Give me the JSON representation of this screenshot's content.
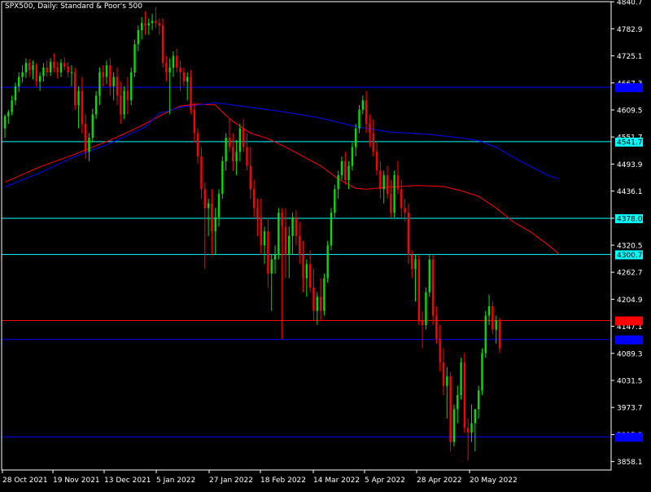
{
  "window": {
    "title": "SPX500, Daily:  Standard & Poor's 500"
  },
  "colors": {
    "background": "#000000",
    "bull": "#00e000",
    "bear": "#ff0000",
    "frame": "#ffffff",
    "ma_fast": "#ff0000",
    "ma_slow": "#0000ff",
    "level_blue": "#0000ff",
    "level_cyan": "#00ffff",
    "level_red": "#ff0000"
  },
  "chart_data": {
    "type": "candlestick",
    "symbol": "SPX500",
    "timeframe": "Daily",
    "title": "SPX500, Daily:  Standard & Poor's 500",
    "y_axis": {
      "ticks": [
        3858.1,
        3915.9,
        3973.7,
        4031.5,
        4089.3,
        4147.1,
        4204.9,
        4262.7,
        4320.5,
        4378.0,
        4436.1,
        4493.9,
        4551.7,
        4609.5,
        4667.3,
        4725.1,
        4782.9,
        4840.7
      ],
      "tick_labels": [
        "3858.1",
        "3915.9",
        "3973.7",
        "4031.5",
        "4089.3",
        "4147.1",
        "4204.9",
        "4262.7",
        "4320.5",
        "4378.0",
        "4436.1",
        "4493.9",
        "4551.7",
        "4609.5",
        "4667.3",
        "4725.1",
        "4782.9",
        "4840.7"
      ],
      "range": [
        3840,
        4841
      ]
    },
    "x_axis": {
      "labels": [
        "28 Oct 2021",
        "19 Nov 2021",
        "13 Dec 2021",
        "5 Jan 2022",
        "27 Jan 2022",
        "18 Feb 2022",
        "14 Mar 2022",
        "5 Apr 2022",
        "28 Apr 2022",
        "20 May 2022"
      ]
    },
    "horizontal_levels": [
      {
        "value": 4658.0,
        "label": "4658.0",
        "color": "#0000ff",
        "label_bg": "#0000ff",
        "label_color": "#0000ff"
      },
      {
        "value": 4541.7,
        "label": "4541.7",
        "color": "#00ffff",
        "label_bg": "#00ffff",
        "label_color": "#000000"
      },
      {
        "value": 4378.0,
        "label": "4378.0",
        "color": "#00ffff",
        "label_bg": "#00ffff",
        "label_color": "#000000"
      },
      {
        "value": 4300.7,
        "label": "4300.7",
        "color": "#00ffff",
        "label_bg": "#00ffff",
        "label_color": "#000000"
      },
      {
        "value": 4159.5,
        "label": "4159.5",
        "color": "#ff0000",
        "label_bg": "#ff0000",
        "label_color": "#ff0000"
      },
      {
        "value": 4119.0,
        "label": "4119.0",
        "color": "#0000ff",
        "label_bg": "#0000ff",
        "label_color": "#0000ff"
      },
      {
        "value": 3911.0,
        "label": "3911.0",
        "color": "#0000ff",
        "label_bg": "#0000ff",
        "label_color": "#0000ff"
      }
    ],
    "moving_averages": [
      {
        "color": "#ff0000",
        "points": [
          [
            0,
            4455
          ],
          [
            10,
            4488
          ],
          [
            20,
            4515
          ],
          [
            30,
            4545
          ],
          [
            35,
            4562
          ],
          [
            40,
            4580
          ],
          [
            45,
            4600
          ],
          [
            50,
            4618
          ],
          [
            55,
            4622
          ],
          [
            60,
            4620
          ],
          [
            62,
            4605
          ],
          [
            65,
            4585
          ],
          [
            68,
            4570
          ],
          [
            70,
            4560
          ],
          [
            75,
            4548
          ],
          [
            80,
            4530
          ],
          [
            85,
            4510
          ],
          [
            90,
            4490
          ],
          [
            95,
            4462
          ],
          [
            100,
            4442
          ],
          [
            103,
            4440
          ],
          [
            110,
            4445
          ],
          [
            118,
            4448
          ],
          [
            125,
            4446
          ],
          [
            130,
            4437
          ],
          [
            135,
            4425
          ],
          [
            140,
            4400
          ],
          [
            145,
            4370
          ],
          [
            150,
            4348
          ],
          [
            155,
            4320
          ],
          [
            158,
            4301
          ]
        ]
      },
      {
        "color": "#0000ff",
        "points": [
          [
            0,
            4445
          ],
          [
            10,
            4475
          ],
          [
            20,
            4510
          ],
          [
            30,
            4538
          ],
          [
            40,
            4573
          ],
          [
            44,
            4602
          ],
          [
            50,
            4615
          ],
          [
            60,
            4625
          ],
          [
            70,
            4615
          ],
          [
            80,
            4605
          ],
          [
            90,
            4592
          ],
          [
            100,
            4574
          ],
          [
            110,
            4562
          ],
          [
            120,
            4558
          ],
          [
            130,
            4550
          ],
          [
            135,
            4544
          ],
          [
            140,
            4530
          ],
          [
            145,
            4508
          ],
          [
            150,
            4488
          ],
          [
            155,
            4469
          ],
          [
            158,
            4462
          ]
        ]
      }
    ],
    "candles": [
      [
        4570,
        4600,
        4550,
        4596
      ],
      [
        4596,
        4610,
        4580,
        4605
      ],
      [
        4605,
        4640,
        4598,
        4630
      ],
      [
        4630,
        4668,
        4620,
        4660
      ],
      [
        4660,
        4690,
        4648,
        4680
      ],
      [
        4680,
        4705,
        4668,
        4690
      ],
      [
        4690,
        4720,
        4678,
        4710
      ],
      [
        4710,
        4718,
        4680,
        4695
      ],
      [
        4695,
        4715,
        4675,
        4705
      ],
      [
        4705,
        4710,
        4660,
        4670
      ],
      [
        4670,
        4690,
        4650,
        4682
      ],
      [
        4682,
        4710,
        4670,
        4700
      ],
      [
        4700,
        4715,
        4680,
        4690
      ],
      [
        4690,
        4720,
        4682,
        4712
      ],
      [
        4712,
        4730,
        4690,
        4700
      ],
      [
        4700,
        4712,
        4676,
        4690
      ],
      [
        4690,
        4718,
        4680,
        4710
      ],
      [
        4710,
        4722,
        4695,
        4702
      ],
      [
        4702,
        4712,
        4680,
        4690
      ],
      [
        4690,
        4705,
        4660,
        4690
      ],
      [
        4690,
        4700,
        4610,
        4620
      ],
      [
        4620,
        4660,
        4570,
        4650
      ],
      [
        4650,
        4680,
        4560,
        4580
      ],
      [
        4580,
        4600,
        4505,
        4520
      ],
      [
        4520,
        4560,
        4500,
        4550
      ],
      [
        4550,
        4612,
        4540,
        4600
      ],
      [
        4600,
        4650,
        4590,
        4640
      ],
      [
        4640,
        4700,
        4620,
        4690
      ],
      [
        4690,
        4705,
        4660,
        4680
      ],
      [
        4680,
        4715,
        4665,
        4705
      ],
      [
        4705,
        4720,
        4640,
        4660
      ],
      [
        4660,
        4690,
        4630,
        4680
      ],
      [
        4680,
        4700,
        4620,
        4640
      ],
      [
        4640,
        4670,
        4580,
        4600
      ],
      [
        4600,
        4660,
        4590,
        4650
      ],
      [
        4650,
        4680,
        4600,
        4630
      ],
      [
        4630,
        4700,
        4620,
        4690
      ],
      [
        4690,
        4760,
        4680,
        4750
      ],
      [
        4750,
        4790,
        4735,
        4780
      ],
      [
        4780,
        4808,
        4760,
        4795
      ],
      [
        4795,
        4820,
        4770,
        4790
      ],
      [
        4790,
        4805,
        4770,
        4795
      ],
      [
        4795,
        4815,
        4780,
        4800
      ],
      [
        4800,
        4830,
        4785,
        4795
      ],
      [
        4795,
        4805,
        4770,
        4790
      ],
      [
        4790,
        4805,
        4700,
        4710
      ],
      [
        4710,
        4725,
        4670,
        4690
      ],
      [
        4690,
        4720,
        4600,
        4700
      ],
      [
        4700,
        4735,
        4680,
        4725
      ],
      [
        4725,
        4740,
        4690,
        4700
      ],
      [
        4700,
        4715,
        4650,
        4690
      ],
      [
        4690,
        4700,
        4660,
        4670
      ],
      [
        4670,
        4690,
        4630,
        4680
      ],
      [
        4680,
        4695,
        4600,
        4610
      ],
      [
        4610,
        4625,
        4540,
        4560
      ],
      [
        4560,
        4570,
        4495,
        4510
      ],
      [
        4510,
        4530,
        4420,
        4440
      ],
      [
        4440,
        4455,
        4270,
        4400
      ],
      [
        4400,
        4420,
        4340,
        4410
      ],
      [
        4410,
        4440,
        4300,
        4350
      ],
      [
        4350,
        4400,
        4300,
        4380
      ],
      [
        4380,
        4440,
        4360,
        4430
      ],
      [
        4430,
        4510,
        4420,
        4500
      ],
      [
        4500,
        4560,
        4480,
        4550
      ],
      [
        4550,
        4590,
        4520,
        4530
      ],
      [
        4530,
        4560,
        4480,
        4500
      ],
      [
        4500,
        4545,
        4470,
        4520
      ],
      [
        4520,
        4580,
        4500,
        4570
      ],
      [
        4570,
        4590,
        4520,
        4530
      ],
      [
        4530,
        4560,
        4480,
        4490
      ],
      [
        4490,
        4530,
        4420,
        4440
      ],
      [
        4440,
        4460,
        4380,
        4400
      ],
      [
        4400,
        4420,
        4340,
        4380
      ],
      [
        4380,
        4420,
        4300,
        4320
      ],
      [
        4320,
        4360,
        4280,
        4350
      ],
      [
        4350,
        4380,
        4230,
        4260
      ],
      [
        4260,
        4300,
        4180,
        4290
      ],
      [
        4290,
        4320,
        4260,
        4300
      ],
      [
        4300,
        4400,
        4290,
        4390
      ],
      [
        4390,
        4400,
        4120,
        4360
      ],
      [
        4360,
        4400,
        4250,
        4300
      ],
      [
        4300,
        4360,
        4250,
        4340
      ],
      [
        4340,
        4390,
        4300,
        4380
      ],
      [
        4380,
        4395,
        4320,
        4340
      ],
      [
        4340,
        4370,
        4280,
        4300
      ],
      [
        4300,
        4330,
        4220,
        4250
      ],
      [
        4250,
        4290,
        4210,
        4280
      ],
      [
        4280,
        4310,
        4220,
        4230
      ],
      [
        4230,
        4270,
        4160,
        4180
      ],
      [
        4180,
        4220,
        4150,
        4210
      ],
      [
        4210,
        4250,
        4160,
        4180
      ],
      [
        4180,
        4260,
        4170,
        4250
      ],
      [
        4250,
        4330,
        4240,
        4320
      ],
      [
        4320,
        4400,
        4310,
        4390
      ],
      [
        4390,
        4450,
        4380,
        4440
      ],
      [
        4440,
        4480,
        4420,
        4470
      ],
      [
        4470,
        4510,
        4460,
        4500
      ],
      [
        4500,
        4520,
        4450,
        4460
      ],
      [
        4460,
        4500,
        4440,
        4490
      ],
      [
        4490,
        4540,
        4480,
        4530
      ],
      [
        4530,
        4580,
        4510,
        4570
      ],
      [
        4570,
        4620,
        4560,
        4610
      ],
      [
        4610,
        4640,
        4600,
        4630
      ],
      [
        4630,
        4650,
        4560,
        4580
      ],
      [
        4580,
        4600,
        4530,
        4560
      ],
      [
        4560,
        4590,
        4510,
        4520
      ],
      [
        4520,
        4540,
        4470,
        4480
      ],
      [
        4480,
        4500,
        4420,
        4440
      ],
      [
        4440,
        4480,
        4410,
        4470
      ],
      [
        4470,
        4490,
        4420,
        4430
      ],
      [
        4430,
        4460,
        4380,
        4390
      ],
      [
        4390,
        4480,
        4380,
        4470
      ],
      [
        4470,
        4500,
        4430,
        4440
      ],
      [
        4440,
        4460,
        4380,
        4400
      ],
      [
        4400,
        4420,
        4370,
        4390
      ],
      [
        4390,
        4410,
        4280,
        4300
      ],
      [
        4300,
        4310,
        4250,
        4270
      ],
      [
        4270,
        4300,
        4200,
        4290
      ],
      [
        4290,
        4300,
        4150,
        4160
      ],
      [
        4160,
        4180,
        4100,
        4150
      ],
      [
        4150,
        4230,
        4140,
        4220
      ],
      [
        4220,
        4300,
        4210,
        4290
      ],
      [
        4290,
        4300,
        4150,
        4170
      ],
      [
        4170,
        4190,
        4110,
        4120
      ],
      [
        4120,
        4150,
        4050,
        4070
      ],
      [
        4070,
        4100,
        4000,
        4020
      ],
      [
        4020,
        4060,
        3950,
        4040
      ],
      [
        4040,
        4050,
        3880,
        3900
      ],
      [
        3900,
        3980,
        3890,
        3970
      ],
      [
        3970,
        4020,
        3940,
        4000
      ],
      [
        4000,
        4080,
        3990,
        4070
      ],
      [
        4070,
        4090,
        3920,
        3930
      ],
      [
        3930,
        3950,
        3860,
        3920
      ],
      [
        3920,
        3980,
        3900,
        3940
      ],
      [
        3940,
        3960,
        3880,
        3970
      ],
      [
        3970,
        4020,
        3950,
        4010
      ],
      [
        4010,
        4100,
        4000,
        4090
      ],
      [
        4090,
        4180,
        4080,
        4170
      ],
      [
        4170,
        4215,
        4150,
        4190
      ],
      [
        4190,
        4200,
        4130,
        4140
      ],
      [
        4140,
        4170,
        4110,
        4160
      ],
      [
        4160,
        4165,
        4090,
        4100
      ]
    ]
  }
}
